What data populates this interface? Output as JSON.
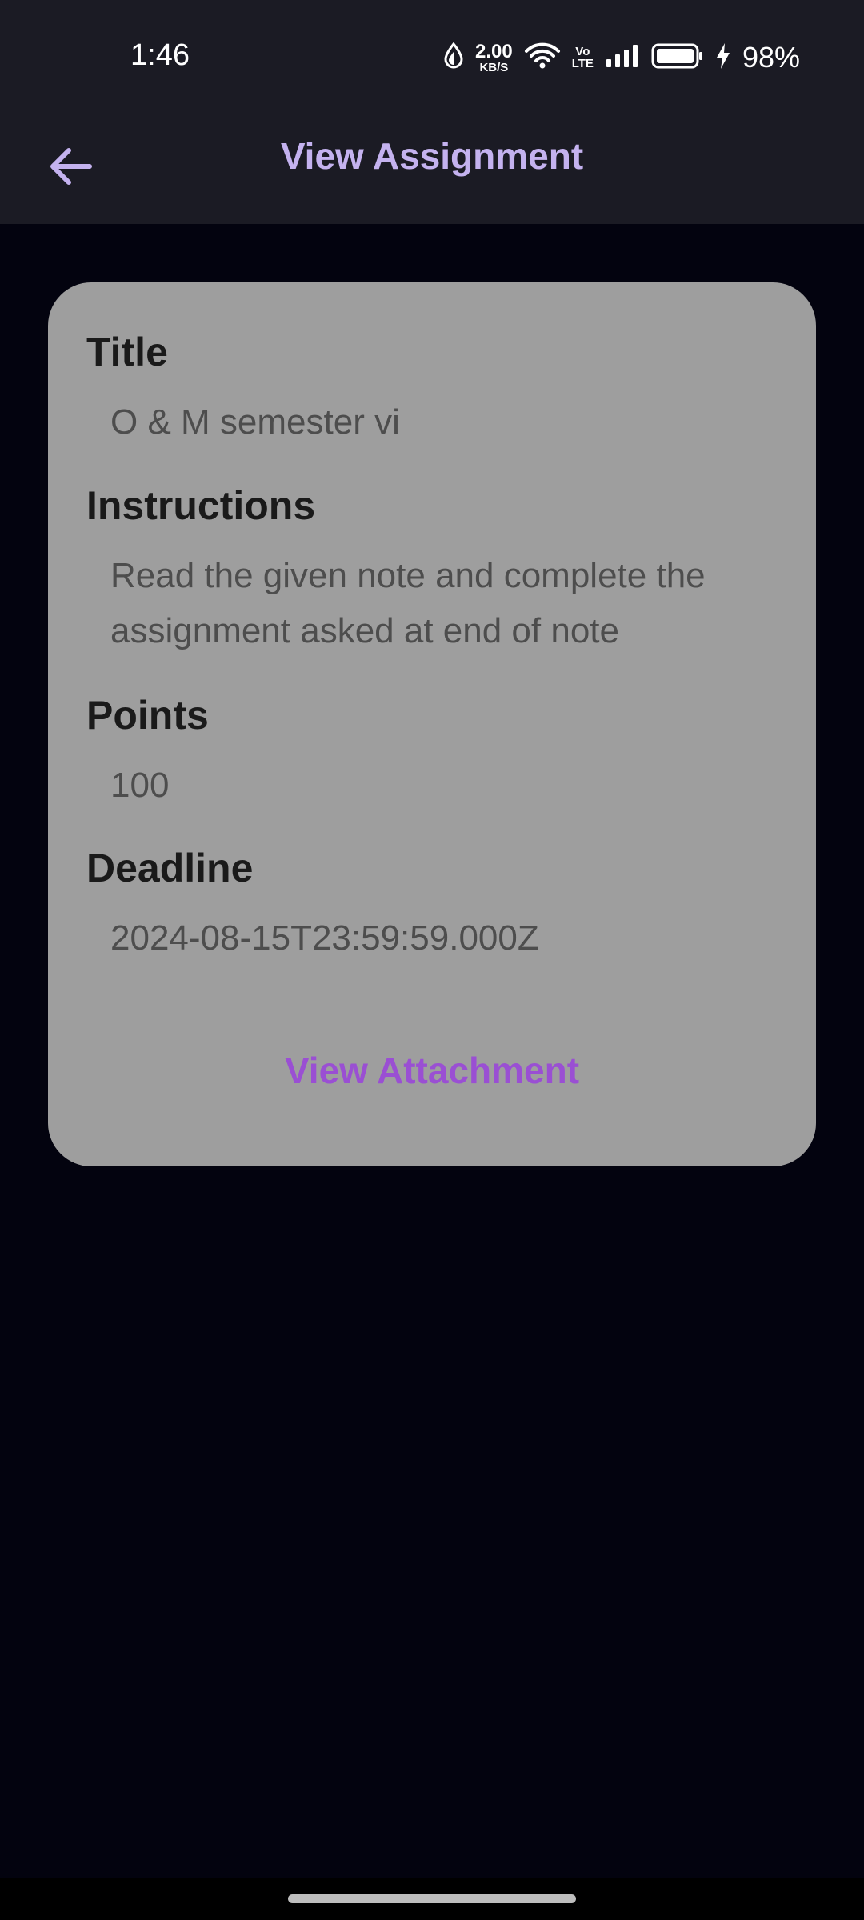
{
  "status_bar": {
    "time": "1:46",
    "net_speed_value": "2.00",
    "net_speed_unit": "KB/S",
    "volte_top": "Vo",
    "volte_bottom": "LTE",
    "battery_percent": "98%",
    "icons": [
      "data-saver-icon",
      "wifi-icon",
      "volte-icon",
      "signal-icon",
      "battery-icon",
      "charging-icon"
    ]
  },
  "app_bar": {
    "title": "View Assignment",
    "back_icon": "arrow-left-icon",
    "accent_color": "#c4b2ef"
  },
  "assignment": {
    "title_label": "Title",
    "title_value": "O & M semester vi",
    "instructions_label": "Instructions",
    "instructions_value": "Read the given note and complete the assignment asked at end of note",
    "points_label": "Points",
    "points_value": "100",
    "deadline_label": "Deadline",
    "deadline_value": "2024-08-15T23:59:59.000Z",
    "attachment_button": "View Attachment",
    "attachment_color": "#9a4fd3",
    "card_color": "#9e9e9e"
  }
}
